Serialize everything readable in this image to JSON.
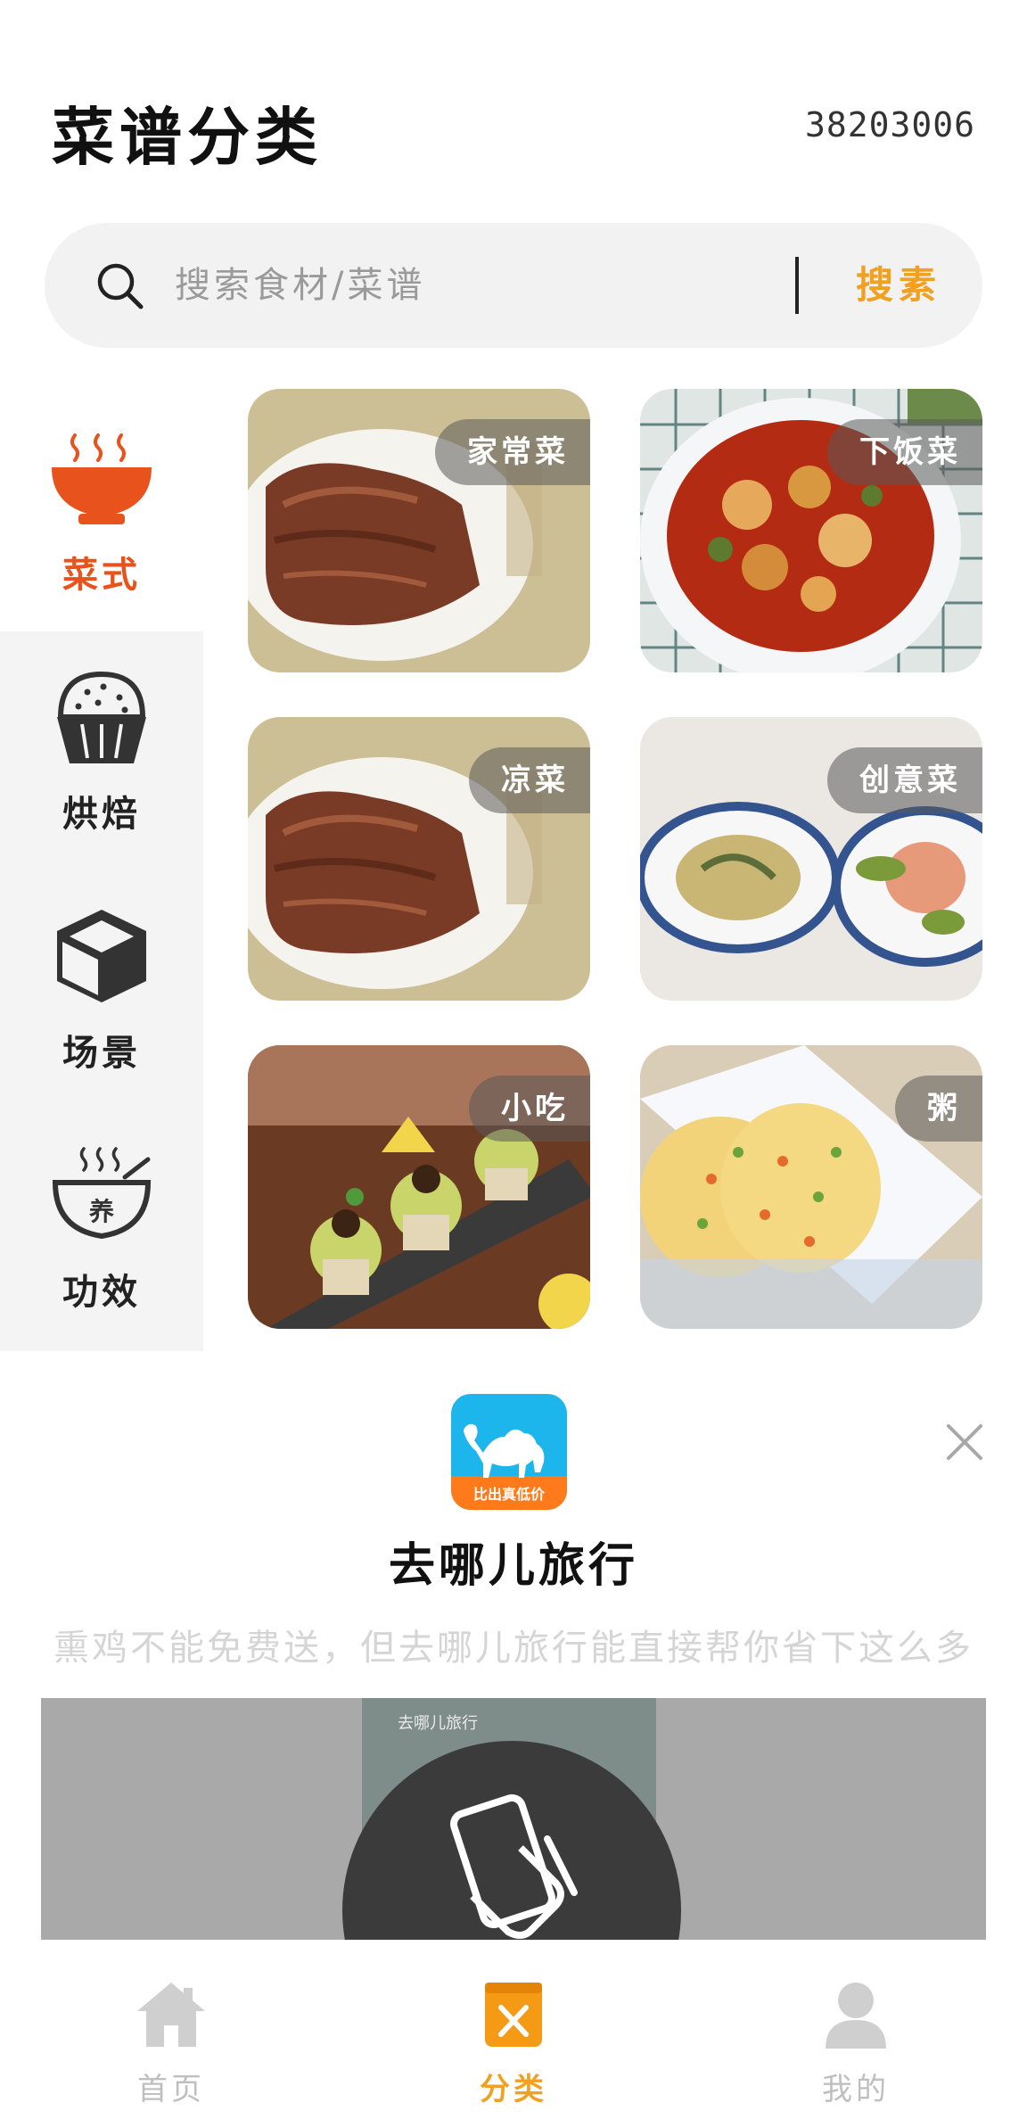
{
  "header": {
    "title": "菜谱分类",
    "code": "38203006"
  },
  "search": {
    "placeholder": "搜索食材/菜谱",
    "button_label": "搜素"
  },
  "sidebar": {
    "items": [
      {
        "label": "菜式",
        "icon": "bowl-icon",
        "active": true
      },
      {
        "label": "烘焙",
        "icon": "cupcake-icon",
        "active": false
      },
      {
        "label": "场景",
        "icon": "cube-icon",
        "active": false
      },
      {
        "label": "功效",
        "icon": "nourish-bowl-icon",
        "active": false
      }
    ]
  },
  "grid": {
    "cards": [
      {
        "tag": "家常菜"
      },
      {
        "tag": "下饭菜"
      },
      {
        "tag": "凉菜"
      },
      {
        "tag": "创意菜"
      },
      {
        "tag": "小吃"
      },
      {
        "tag": "粥"
      }
    ]
  },
  "ad": {
    "name": "去哪儿旅行",
    "description": "熏鸡不能免费送，但去哪儿旅行能直接帮你省下这么多",
    "logo_text": "比出真低价"
  },
  "nav": {
    "items": [
      {
        "label": "首页",
        "icon": "home-icon",
        "active": false
      },
      {
        "label": "分类",
        "icon": "category-icon",
        "active": true
      },
      {
        "label": "我的",
        "icon": "profile-icon",
        "active": false
      }
    ]
  },
  "colors": {
    "accent": "#f0a122",
    "active_category": "#e8521d",
    "sidebar_bg": "#f4f4f4"
  }
}
